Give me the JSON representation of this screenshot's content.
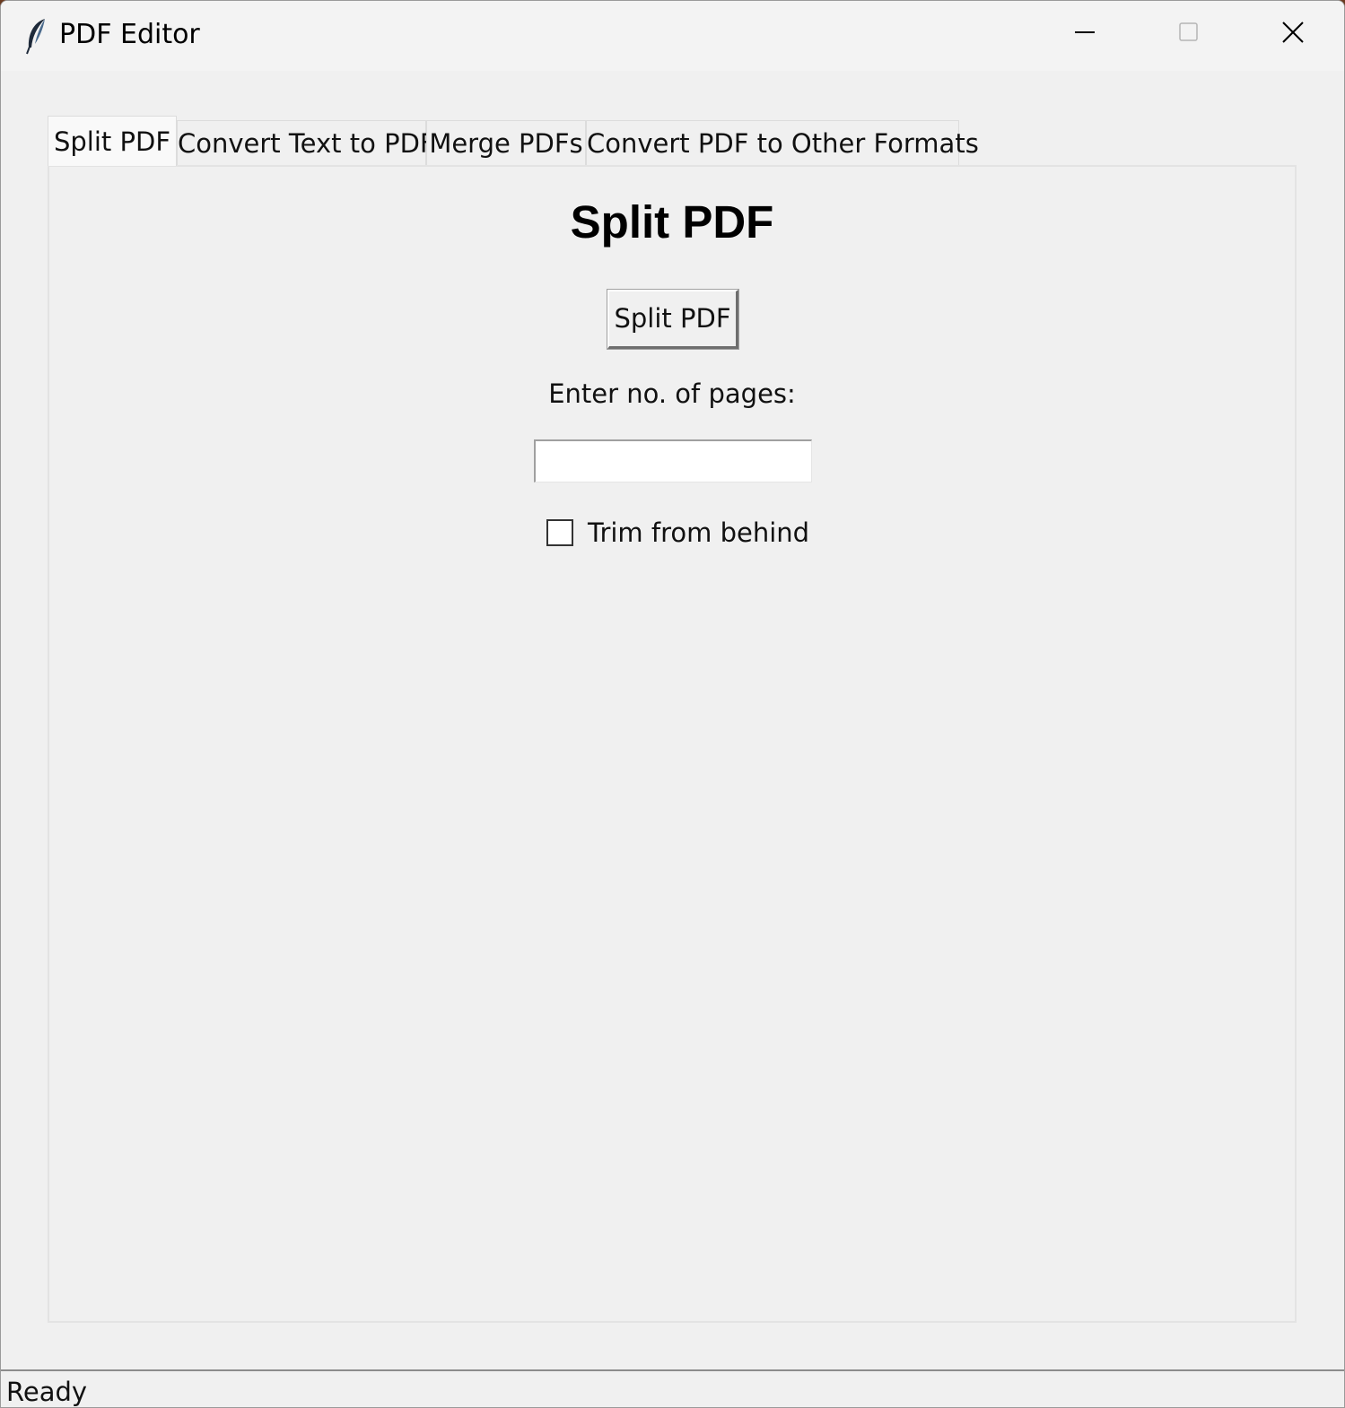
{
  "window": {
    "title": "PDF Editor",
    "icon": "feather-icon",
    "controls": {
      "minimize": "minimize-icon",
      "maximize": "maximize-icon",
      "close": "close-icon"
    }
  },
  "tabs": [
    {
      "label": "Split PDF",
      "active": true
    },
    {
      "label": "Convert Text to PDF",
      "active": false
    },
    {
      "label": "Merge PDFs",
      "active": false
    },
    {
      "label": "Convert PDF to Other Formats",
      "active": false
    }
  ],
  "split_tab": {
    "heading": "Split PDF",
    "split_button_label": "Split PDF",
    "pages_label": "Enter no. of pages:",
    "pages_value": "",
    "pages_placeholder": "",
    "trim_checkbox_label": "Trim from behind",
    "trim_checked": false
  },
  "status_bar": {
    "text": "Ready"
  },
  "colors": {
    "window_bg": "#f0f0f0",
    "titlebar_bg": "#f3f3f3",
    "active_tab_bg": "#f9f9f9"
  }
}
